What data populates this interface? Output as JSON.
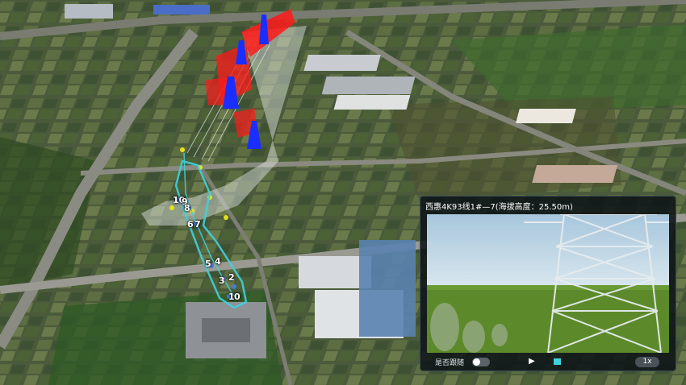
{
  "panel": {
    "title": "西惠4K93线1#—7(海拔高度：25.50m)",
    "follow_label": "是否跟随",
    "speed_label": "1x"
  },
  "waypoints": [
    "1",
    "2",
    "3",
    "4",
    "5",
    "6",
    "7",
    "8",
    "9",
    "10"
  ],
  "icons": {
    "play": "play-icon",
    "stop": "stop-icon"
  },
  "colors": {
    "path_highlight": "#3fd2dd",
    "tower_red": "#ff1a1a",
    "tower_blue": "#1a2fff",
    "waypoint_yellow": "#e6e01e"
  }
}
